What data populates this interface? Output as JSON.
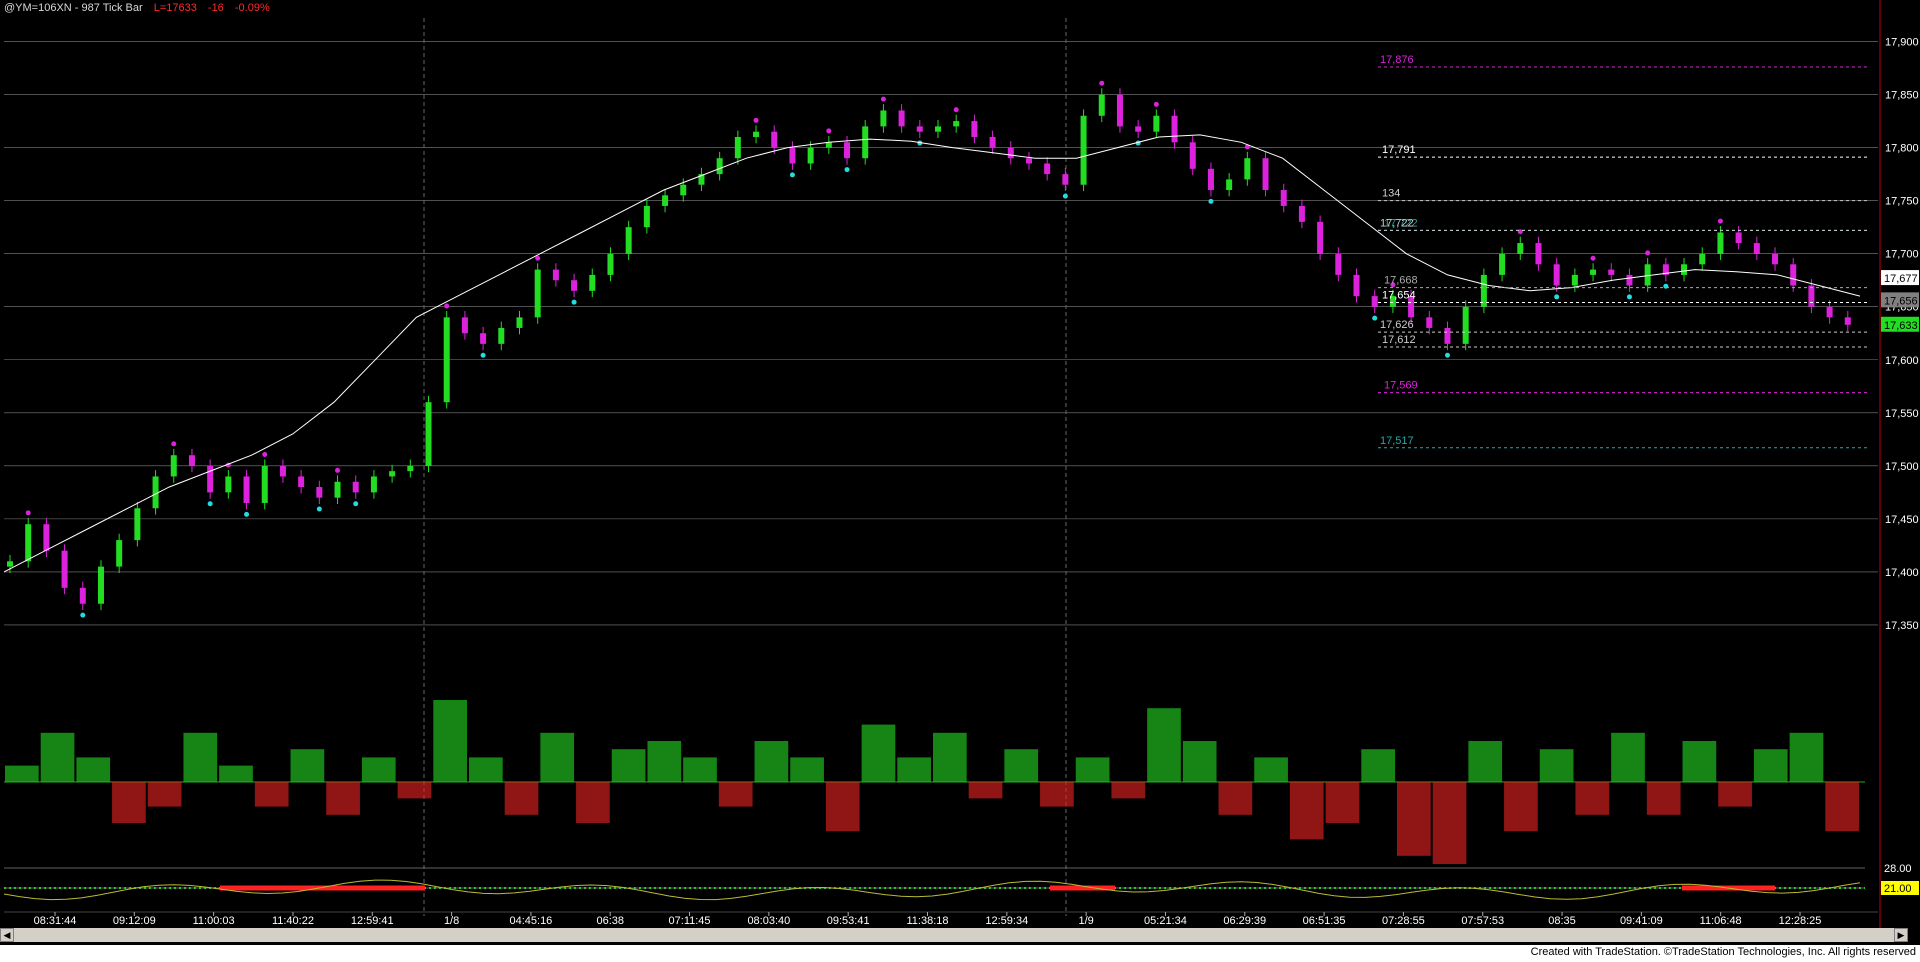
{
  "window": {
    "symbol": "@YM=106XN - 987 Tick Bar",
    "last_quote": "L=17633",
    "change": "-16",
    "change_pct": "-0.09%"
  },
  "footer": {
    "credit": "Created with TradeStation. ©TradeStation Technologies, Inc. All rights reserved"
  },
  "colors": {
    "background": "#000000",
    "up_bar": "#22dd22",
    "down_bar": "#dd22dd",
    "moving_avg": "#ffffff",
    "gridline": "#808080",
    "volume_up": "#22cc22",
    "volume_down": "#dd2222",
    "pivot_high": "#dd22dd",
    "pivot_low": "#22dddd"
  },
  "icons": {
    "scroll_left": "triangle-left-icon",
    "scroll_right": "triangle-right-icon",
    "buy_arrow": "arrow-up-icon",
    "sell_arrow": "arrow-down-icon"
  },
  "chart_data": {
    "type": "candlestick",
    "ylim": [
      17300,
      17925
    ],
    "y_ticks": [
      "17,900",
      "17,850",
      "17,800",
      "17,750",
      "17,700",
      "17,650",
      "17,600",
      "17,550",
      "17,500",
      "17,450",
      "17,400",
      "17,350"
    ],
    "x_ticks": [
      "08:31:44",
      "09:12:09",
      "11:00:03",
      "11:40:22",
      "12:59:41",
      "1/8",
      "04:45:16",
      "06:38",
      "07:11:45",
      "08:03:40",
      "09:53:41",
      "11:38:18",
      "12:59:34",
      "1/9",
      "05:21:34",
      "06:29:39",
      "06:51:35",
      "07:28:55",
      "07:57:53",
      "08:35",
      "09:41:09",
      "11:06:48",
      "12:28:25"
    ],
    "close_path": [
      17410,
      17445,
      17420,
      17385,
      17370,
      17405,
      17430,
      17460,
      17490,
      17510,
      17500,
      17475,
      17490,
      17465,
      17500,
      17490,
      17480,
      17470,
      17485,
      17475,
      17490,
      17495,
      17500,
      17560,
      17640,
      17625,
      17615,
      17630,
      17640,
      17685,
      17675,
      17665,
      17680,
      17700,
      17725,
      17745,
      17755,
      17765,
      17775,
      17790,
      17810,
      17815,
      17800,
      17785,
      17800,
      17805,
      17790,
      17820,
      17835,
      17820,
      17815,
      17820,
      17825,
      17810,
      17800,
      17790,
      17785,
      17775,
      17765,
      17830,
      17850,
      17820,
      17815,
      17830,
      17805,
      17780,
      17760,
      17770,
      17790,
      17760,
      17745,
      17730,
      17700,
      17680,
      17660,
      17650,
      17660,
      17640,
      17630,
      17615,
      17650,
      17680,
      17700,
      17710,
      17690,
      17670,
      17680,
      17685,
      17680,
      17670,
      17690,
      17680,
      17690,
      17700,
      17720,
      17710,
      17700,
      17690,
      17670,
      17650,
      17640,
      17633
    ],
    "moving_average": [
      17400,
      17420,
      17440,
      17460,
      17480,
      17495,
      17510,
      17530,
      17560,
      17600,
      17640,
      17660,
      17680,
      17700,
      17720,
      17740,
      17760,
      17775,
      17790,
      17800,
      17805,
      17808,
      17806,
      17800,
      17795,
      17790,
      17790,
      17800,
      17810,
      17812,
      17805,
      17790,
      17760,
      17730,
      17700,
      17680,
      17670,
      17665,
      17668,
      17675,
      17680,
      17685,
      17683,
      17680,
      17670,
      17660
    ],
    "price_levels": [
      {
        "label": "17,876",
        "value": 17876,
        "color": "#dd22dd"
      },
      {
        "label": "17,791",
        "value": 17791,
        "color": "#ffffff"
      },
      {
        "label": "17,722",
        "value": 17722,
        "color": "#22aaaa"
      },
      {
        "label": "17,722",
        "value": 17722,
        "color": "#cccccc"
      },
      {
        "label": "17,654",
        "value": 17654,
        "color": "#ffffff"
      },
      {
        "label": "17,668",
        "value": 17668,
        "color": "#aaaaaa"
      },
      {
        "label": "17,626",
        "value": 17626,
        "color": "#cccccc"
      },
      {
        "label": "17,612",
        "value": 17612,
        "color": "#cccccc"
      },
      {
        "label": "17,569",
        "value": 17569,
        "color": "#dd22dd"
      },
      {
        "label": "17,517",
        "value": 17517,
        "color": "#22aaaa"
      },
      {
        "label": "134",
        "value": 17750,
        "color": "#cccccc"
      }
    ],
    "price_badges": [
      {
        "label": "17,677",
        "value": 17677,
        "bg": "#ffffff",
        "fg": "#000000"
      },
      {
        "label": "17,656",
        "value": 17656,
        "bg": "#808080",
        "fg": "#000000"
      },
      {
        "label": "17,633",
        "value": 17633,
        "bg": "#22dd22",
        "fg": "#000000"
      }
    ],
    "volume_histogram": [
      0.2,
      0.6,
      0.3,
      -0.5,
      -0.3,
      0.6,
      0.2,
      -0.3,
      0.4,
      -0.4,
      0.3,
      -0.2,
      1.0,
      0.3,
      -0.4,
      0.6,
      -0.5,
      0.4,
      0.5,
      0.3,
      -0.3,
      0.5,
      0.3,
      -0.6,
      0.7,
      0.3,
      0.6,
      -0.2,
      0.4,
      -0.3,
      0.3,
      -0.2,
      0.9,
      0.5,
      -0.4,
      0.3,
      -0.7,
      -0.5,
      0.4,
      -0.9,
      -1.0,
      0.5,
      -0.6,
      0.4,
      -0.4,
      0.6,
      -0.4,
      0.5,
      -0.3,
      0.4,
      0.6,
      -0.6
    ],
    "indicator_levels": [
      {
        "label": "28.00",
        "value": 28
      },
      {
        "label": "21.00",
        "value": 21
      }
    ]
  }
}
